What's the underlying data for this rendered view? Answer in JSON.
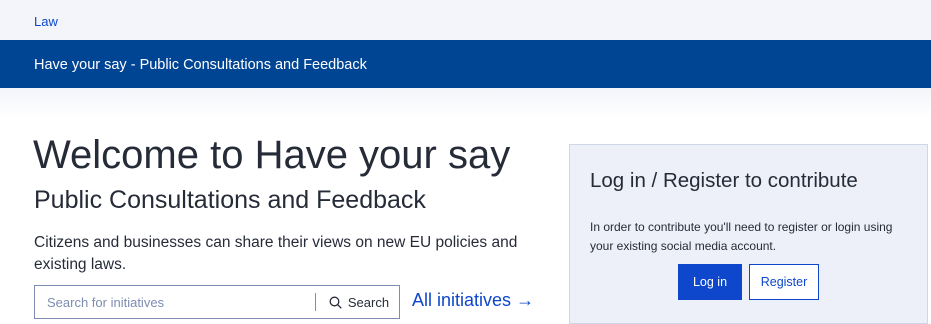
{
  "breadcrumb": {
    "label": "Law"
  },
  "header": {
    "title": "Have your say - Public Consultations and Feedback"
  },
  "hero": {
    "title": "Welcome to Have your say",
    "subtitle": "Public Consultations and Feedback",
    "description": "Citizens and businesses can share their views on new EU policies and existing laws."
  },
  "search": {
    "placeholder": "Search for initiatives",
    "value": "",
    "button_label": "Search",
    "icon": "search-icon"
  },
  "all_initiatives": {
    "label": "All initiatives",
    "arrow": "→"
  },
  "login_panel": {
    "title": "Log in / Register to contribute",
    "text": "In order to contribute you'll need to register or login using your existing social media account.",
    "login_label": "Log in",
    "register_label": "Register"
  },
  "colors": {
    "brand_blue": "#004494",
    "link_blue": "#0e47cb",
    "panel_bg": "#edf0f8"
  }
}
